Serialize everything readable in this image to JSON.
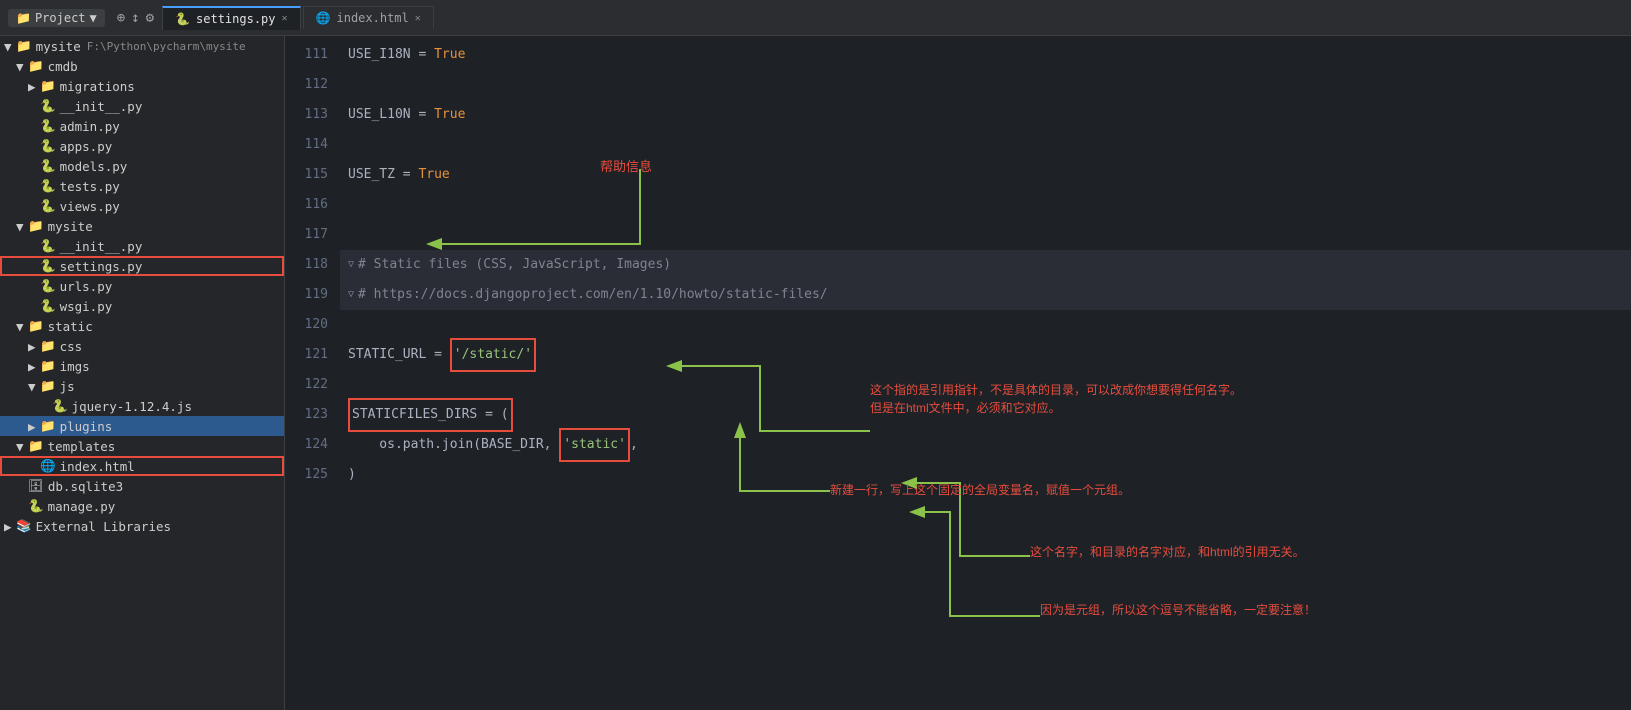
{
  "topbar": {
    "project_label": "Project",
    "project_name": "mysite",
    "project_path": "F:\\Python\\pycharm\\mysite",
    "tabs": [
      {
        "label": "settings.py",
        "active": true,
        "modified": false
      },
      {
        "label": "index.html",
        "active": false,
        "modified": false
      }
    ]
  },
  "sidebar": {
    "root": {
      "label": "mysite",
      "path": "F:\\Python\\pycharm\\mysite"
    },
    "tree": [
      {
        "id": "mysite-root",
        "label": "mysite",
        "type": "folder",
        "level": 0,
        "expanded": true,
        "icon": "📁"
      },
      {
        "id": "cmdb",
        "label": "cmdb",
        "type": "folder",
        "level": 1,
        "expanded": true,
        "icon": "📁"
      },
      {
        "id": "migrations",
        "label": "migrations",
        "type": "folder",
        "level": 2,
        "expanded": false,
        "icon": "📁"
      },
      {
        "id": "init-cmdb",
        "label": "__init__.py",
        "type": "file",
        "level": 2,
        "icon": "🐍"
      },
      {
        "id": "admin-py",
        "label": "admin.py",
        "type": "file",
        "level": 2,
        "icon": "🐍"
      },
      {
        "id": "apps-py",
        "label": "apps.py",
        "type": "file",
        "level": 2,
        "icon": "🐍"
      },
      {
        "id": "models-py",
        "label": "models.py",
        "type": "file",
        "level": 2,
        "icon": "🐍"
      },
      {
        "id": "tests-py",
        "label": "tests.py",
        "type": "file",
        "level": 2,
        "icon": "🐍"
      },
      {
        "id": "views-py",
        "label": "views.py",
        "type": "file",
        "level": 2,
        "icon": "🐍"
      },
      {
        "id": "mysite-pkg",
        "label": "mysite",
        "type": "folder",
        "level": 1,
        "expanded": true,
        "icon": "📁"
      },
      {
        "id": "init-mysite",
        "label": "__init__.py",
        "type": "file",
        "level": 2,
        "icon": "🐍"
      },
      {
        "id": "settings-py",
        "label": "settings.py",
        "type": "file",
        "level": 2,
        "icon": "🐍",
        "highlighted": true
      },
      {
        "id": "urls-py",
        "label": "urls.py",
        "type": "file",
        "level": 2,
        "icon": "🐍"
      },
      {
        "id": "wsgi-py",
        "label": "wsgi.py",
        "type": "file",
        "level": 2,
        "icon": "🐍"
      },
      {
        "id": "static",
        "label": "static",
        "type": "folder",
        "level": 1,
        "expanded": true,
        "icon": "📁"
      },
      {
        "id": "css",
        "label": "css",
        "type": "folder",
        "level": 2,
        "expanded": false,
        "icon": "📁"
      },
      {
        "id": "imgs",
        "label": "imgs",
        "type": "folder",
        "level": 2,
        "expanded": false,
        "icon": "📁"
      },
      {
        "id": "js",
        "label": "js",
        "type": "folder",
        "level": 2,
        "expanded": true,
        "icon": "📁"
      },
      {
        "id": "jquery",
        "label": "jquery-1.12.4.js",
        "type": "file",
        "level": 3,
        "icon": "🐍"
      },
      {
        "id": "plugins",
        "label": "plugins",
        "type": "folder",
        "level": 2,
        "selected": true,
        "icon": "📁"
      },
      {
        "id": "templates",
        "label": "templates",
        "type": "folder",
        "level": 1,
        "expanded": true,
        "icon": "📁"
      },
      {
        "id": "index-html",
        "label": "index.html",
        "type": "file",
        "level": 2,
        "icon": "🌐",
        "highlighted": true
      },
      {
        "id": "db-sqlite3",
        "label": "db.sqlite3",
        "type": "file",
        "level": 1,
        "icon": "🗄️"
      },
      {
        "id": "manage-py",
        "label": "manage.py",
        "type": "file",
        "level": 1,
        "icon": "🐍"
      },
      {
        "id": "ext-libs",
        "label": "External Libraries",
        "type": "folder",
        "level": 0,
        "icon": "📚"
      }
    ]
  },
  "editor": {
    "filename": "settings.py",
    "lines": [
      {
        "num": 111,
        "content": "USE_I18N = True",
        "tokens": [
          {
            "text": "USE_I18N",
            "class": "kw-white"
          },
          {
            "text": " = ",
            "class": "kw-white"
          },
          {
            "text": "True",
            "class": "kw-orange"
          }
        ]
      },
      {
        "num": 112,
        "content": "",
        "tokens": []
      },
      {
        "num": 113,
        "content": "USE_L10N = True",
        "tokens": [
          {
            "text": "USE_L10N",
            "class": "kw-white"
          },
          {
            "text": " = ",
            "class": "kw-white"
          },
          {
            "text": "True",
            "class": "kw-orange"
          }
        ]
      },
      {
        "num": 114,
        "content": "",
        "tokens": []
      },
      {
        "num": 115,
        "content": "USE_TZ = True",
        "tokens": [
          {
            "text": "USE_TZ",
            "class": "kw-white"
          },
          {
            "text": " = ",
            "class": "kw-white"
          },
          {
            "text": "True",
            "class": "kw-orange"
          }
        ]
      },
      {
        "num": 116,
        "content": "",
        "tokens": []
      },
      {
        "num": 117,
        "content": "",
        "tokens": []
      },
      {
        "num": 118,
        "content": "# Static files (CSS, JavaScript, Images)",
        "tokens": [
          {
            "text": "# Static files (CSS, JavaScript, Images)",
            "class": "comment"
          }
        ]
      },
      {
        "num": 119,
        "content": "# https://docs.djangoproject.com/en/1.10/howto/static-files/",
        "tokens": [
          {
            "text": "# https://docs.djangoproject.com/en/1.10/howto/static-files/",
            "class": "comment"
          }
        ]
      },
      {
        "num": 120,
        "content": "",
        "tokens": []
      },
      {
        "num": 121,
        "content": "STATIC_URL = '/static/'",
        "tokens": [
          {
            "text": "STATIC_URL",
            "class": "kw-white"
          },
          {
            "text": " = ",
            "class": "kw-white"
          },
          {
            "text": "'/static/'",
            "class": "kw-green"
          }
        ]
      },
      {
        "num": 122,
        "content": "",
        "tokens": []
      },
      {
        "num": 123,
        "content": "STATICFILES_DIRS= (",
        "tokens": [
          {
            "text": "STATICFILES_DIRS",
            "class": "kw-white"
          },
          {
            "text": "= (",
            "class": "kw-white"
          }
        ]
      },
      {
        "num": 124,
        "content": "    os.path.join(BASE_DIR, 'static'),",
        "tokens": [
          {
            "text": "    os.path.join(BASE_DIR, ",
            "class": "kw-white"
          },
          {
            "text": "'static'",
            "class": "kw-green"
          },
          {
            "text": "),",
            "class": "kw-white"
          }
        ]
      },
      {
        "num": 125,
        "content": ")",
        "tokens": [
          {
            "text": ")",
            "class": "kw-white"
          }
        ]
      }
    ]
  },
  "annotations": {
    "help_label": "帮助信息",
    "annotation1": "这个指的是引用指针，不是具体的目录，可以改成你想要得任何名字。",
    "annotation1b": "但是在html文件中，必须和它对应。",
    "annotation2": "新建一行，写上这个固定的全局变量名，赋值一个元组。",
    "annotation3": "这个名字，和目录的名字对应，和html的引用无关。",
    "annotation4": "因为是元组，所以这个逗号不能省略，一定要注意！"
  },
  "colors": {
    "background": "#1e2227",
    "sidebar_bg": "#252629",
    "tab_active": "#1e2227",
    "accent_blue": "#4a9eff",
    "red": "#e74c3c",
    "green": "#4caf50",
    "orange": "#e5913e",
    "code_green": "#98c379"
  }
}
